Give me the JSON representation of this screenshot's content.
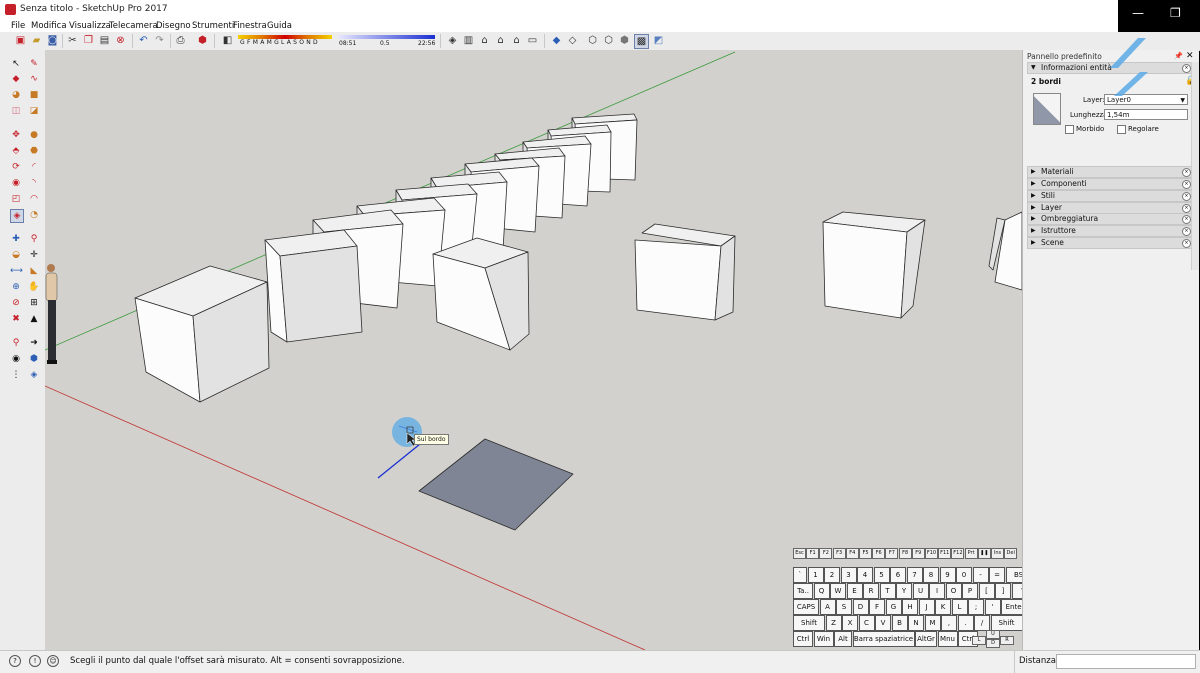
{
  "window": {
    "title": "Senza titolo - SketchUp Pro 2017"
  },
  "menubar": [
    "File",
    "Modifica",
    "Visualizza",
    "Telecamera",
    "Disegno",
    "Strumenti",
    "Finestra",
    "Guida"
  ],
  "shadow": {
    "months": "G F M A M G L A S O N D",
    "time_start": "08:51",
    "mid": "0.5",
    "time_end": "22:56"
  },
  "colors": {
    "viewport_bg": "#d2d1cd",
    "face_white": "#fcfcfc",
    "face_shade": "#e2e2e2",
    "edge": "#2b2b2b",
    "axis_red": "#c0312d",
    "axis_green": "#3c9a3c",
    "axis_blue": "#1a2fd0",
    "selected_face": "#7f8594",
    "cursor_glow": "#5aa9e6"
  },
  "cursor_tooltip": "Sul bordo",
  "panel": {
    "title": "Pannello predefinito",
    "entity_info": {
      "header": "Informazioni entità",
      "selection": "2 bordi",
      "layer_label": "Layer:",
      "layer_value": "Layer0",
      "length_label": "Lunghezza:",
      "length_value": "1,54m",
      "smooth_label": "Morbido",
      "soften_label": "Regolare"
    },
    "sections": [
      "Materiali",
      "Componenti",
      "Stili",
      "Layer",
      "Ombreggiatura",
      "Istruttore",
      "Scene"
    ]
  },
  "keyboard": {
    "fkeys": [
      "Esc",
      "F1",
      "F2",
      "F3",
      "F4",
      "F5",
      "F6",
      "F7",
      "F8",
      "F9",
      "F10",
      "F11",
      "F12",
      "Prt",
      "❚❚",
      "Ins",
      "Del"
    ],
    "row1": [
      "`",
      "1",
      "2",
      "3",
      "4",
      "5",
      "6",
      "7",
      "8",
      "9",
      "0",
      "-",
      "=",
      "BS"
    ],
    "row2": [
      "Ta..",
      "Q",
      "W",
      "E",
      "R",
      "T",
      "Y",
      "U",
      "I",
      "O",
      "P",
      "[",
      "]",
      "\\"
    ],
    "row3": [
      "CAPS",
      "A",
      "S",
      "D",
      "F",
      "G",
      "H",
      "J",
      "K",
      "L",
      ";",
      "'",
      "Enter"
    ],
    "row4": [
      "Shift",
      "Z",
      "X",
      "C",
      "V",
      "B",
      "N",
      "M",
      ",",
      ".",
      "/",
      "Shift"
    ],
    "row5": [
      "Ctrl",
      "Win",
      "Alt",
      "Barra spaziatrice",
      "AltGr",
      "Mnu",
      "Ctrl"
    ],
    "arrows": {
      "up": "U",
      "left": "L",
      "down": "D",
      "right": "R"
    }
  },
  "status": {
    "message": "Scegli il punto dal quale l'offset sarà misurato. Alt = consenti sovrapposizione.",
    "vcb_label": "Distanza",
    "vcb_value": ""
  }
}
